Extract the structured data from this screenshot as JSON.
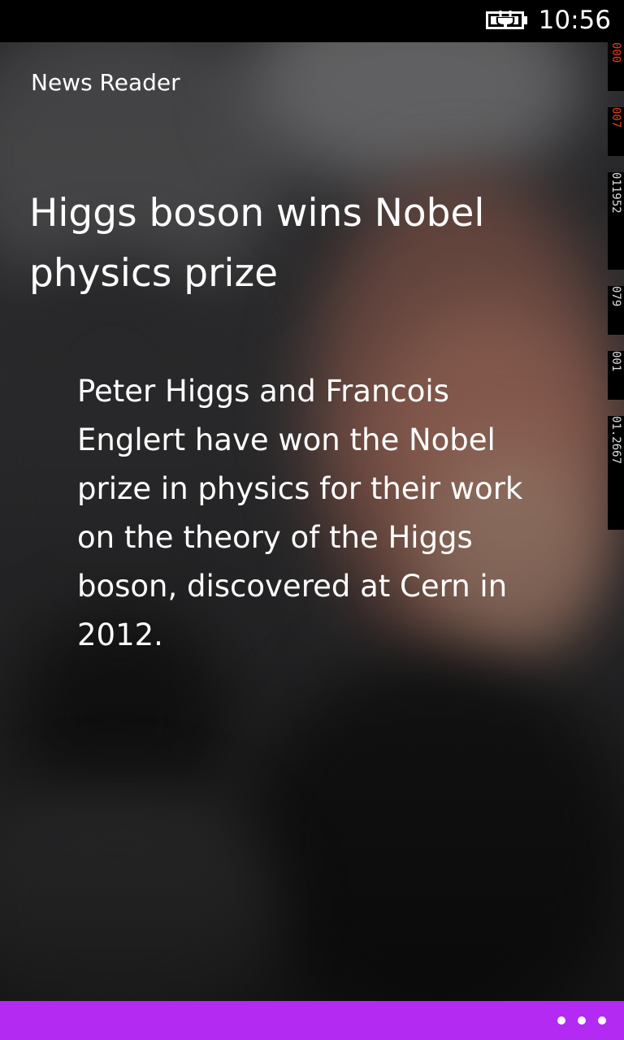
{
  "status_bar": {
    "time": "10:56",
    "battery_icon": "battery-charging-icon"
  },
  "app": {
    "title": "News Reader"
  },
  "article": {
    "headline": "Higgs boson wins Nobel physics prize",
    "body": "Peter Higgs and Francois Englert have won the Nobel prize in physics for their work on the theory of the Higgs boson, discovered at Cern in 2012."
  },
  "frame_counters": [
    "000",
    "007",
    "011952",
    "079",
    "001",
    "01.2667"
  ],
  "app_bar": {
    "more_icon": "ellipsis-icon",
    "color": "#b32af2"
  }
}
